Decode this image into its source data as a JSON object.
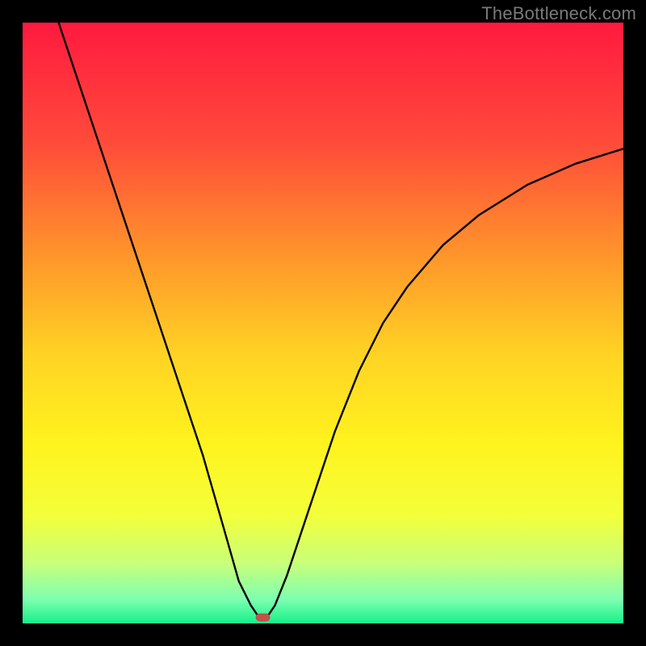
{
  "watermark": "TheBottleneck.com",
  "chart_data": {
    "type": "line",
    "title": "",
    "xlabel": "",
    "ylabel": "",
    "xlim": [
      0,
      100
    ],
    "ylim": [
      0,
      100
    ],
    "grid": false,
    "legend": false,
    "series": [
      {
        "name": "curve",
        "x": [
          6,
          10,
          14,
          18,
          22,
          26,
          30,
          34,
          36,
          38,
          39,
          40,
          41,
          42,
          44,
          48,
          52,
          56,
          60,
          64,
          70,
          76,
          84,
          92,
          100
        ],
        "y": [
          100,
          88,
          76,
          64,
          52,
          40,
          28,
          14,
          7,
          3,
          1.5,
          1,
          1.5,
          3,
          8,
          20,
          32,
          42,
          50,
          56,
          63,
          68,
          73,
          76.5,
          79
        ]
      }
    ],
    "annotations": [
      {
        "name": "valley-marker",
        "x": 40,
        "y": 1
      }
    ],
    "background_gradient": {
      "stops": [
        {
          "pos": 0.0,
          "color": "#ff1a3f"
        },
        {
          "pos": 0.2,
          "color": "#ff4b3a"
        },
        {
          "pos": 0.4,
          "color": "#ff9a2a"
        },
        {
          "pos": 0.55,
          "color": "#ffd224"
        },
        {
          "pos": 0.7,
          "color": "#fff31e"
        },
        {
          "pos": 0.82,
          "color": "#f3ff3a"
        },
        {
          "pos": 0.9,
          "color": "#c8ff7a"
        },
        {
          "pos": 0.96,
          "color": "#7dffb0"
        },
        {
          "pos": 1.0,
          "color": "#16f08a"
        }
      ]
    }
  }
}
